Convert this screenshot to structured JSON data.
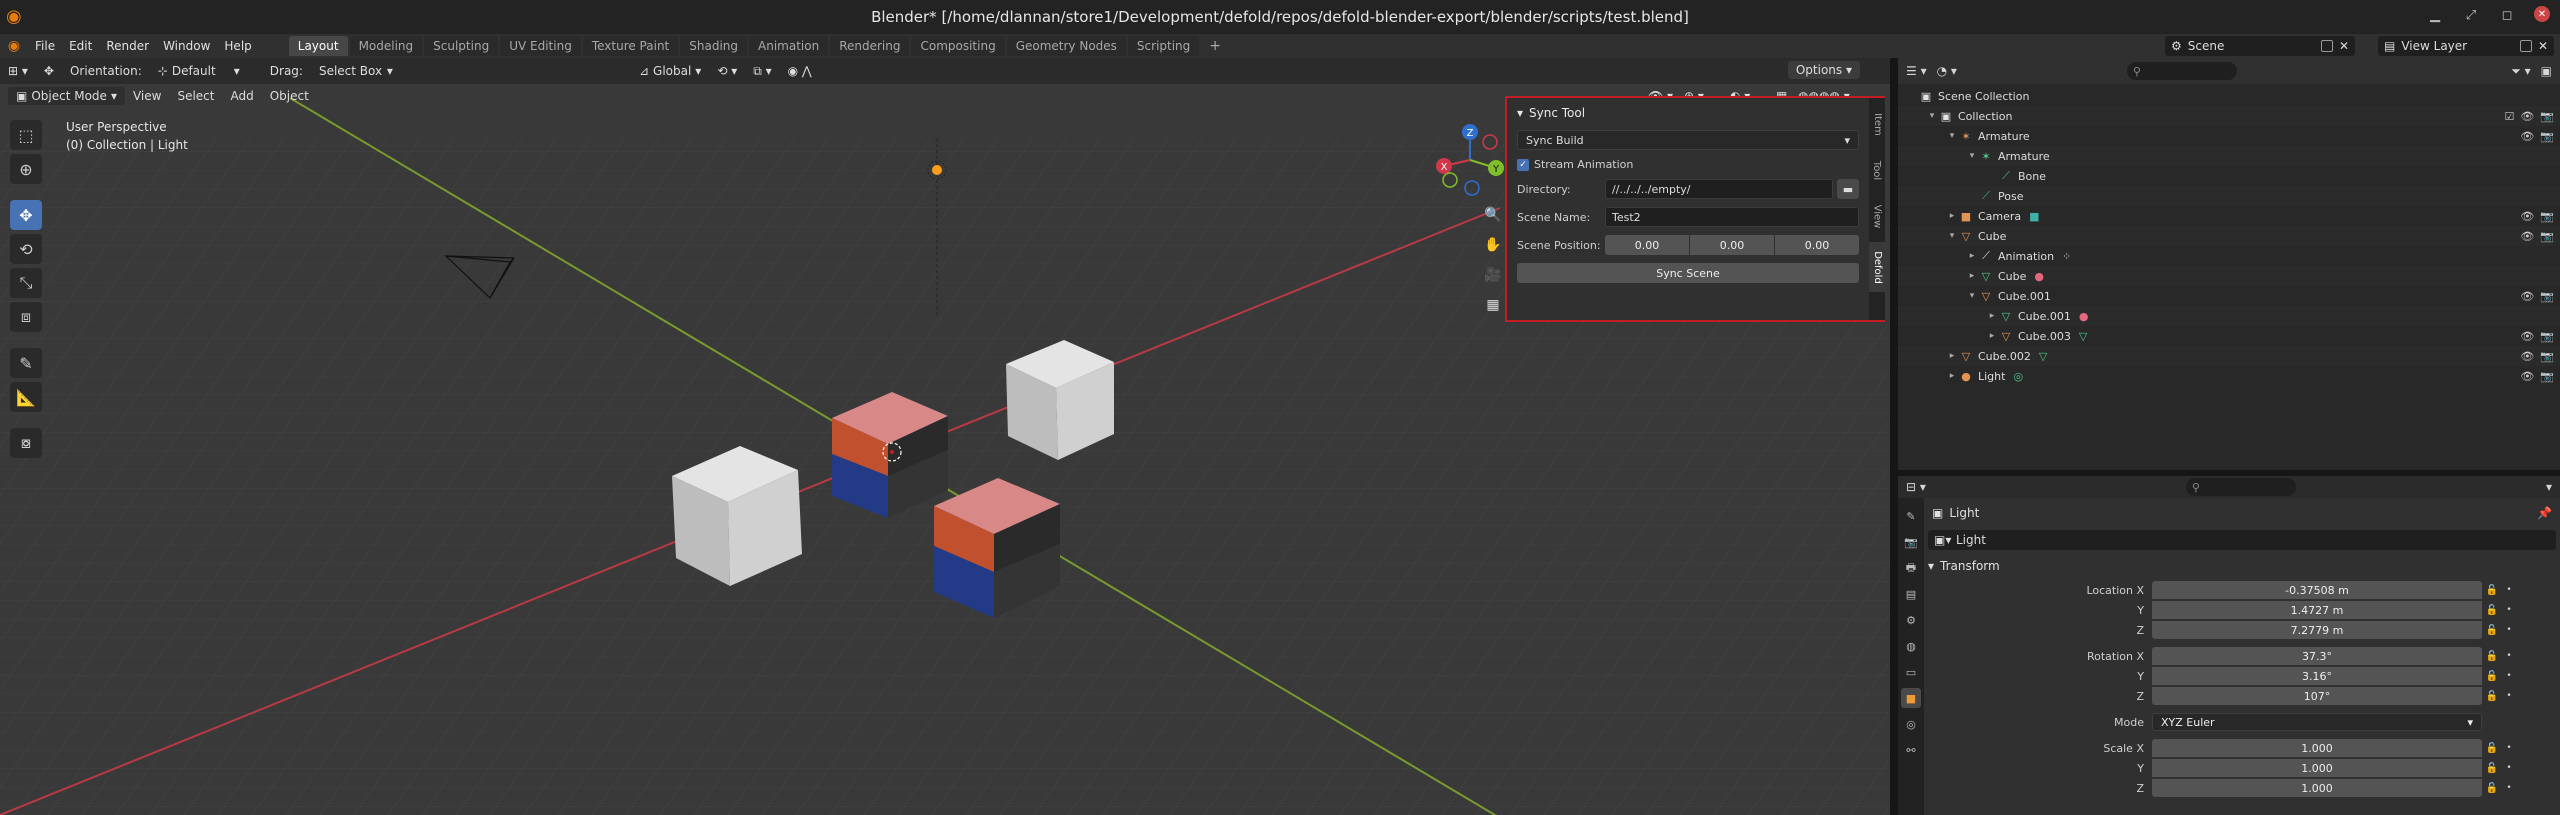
{
  "window": {
    "title": "Blender* [/home/dlannan/store1/Development/defold/repos/defold-blender-export/blender/scripts/test.blend]"
  },
  "menubar": {
    "menus": [
      "File",
      "Edit",
      "Render",
      "Window",
      "Help"
    ],
    "workspaces": [
      "Layout",
      "Modeling",
      "Sculpting",
      "UV Editing",
      "Texture Paint",
      "Shading",
      "Animation",
      "Rendering",
      "Compositing",
      "Geometry Nodes",
      "Scripting"
    ],
    "active_workspace": "Layout",
    "scene": "Scene",
    "view_layer": "View Layer"
  },
  "viewport_header": {
    "orientation_label": "Orientation:",
    "orientation_value": "Default",
    "drag_label": "Drag:",
    "drag_value": "Select Box",
    "transform_orientation": "Global",
    "options": "Options",
    "mode": "Object Mode",
    "menus": [
      "View",
      "Select",
      "Add",
      "Object"
    ]
  },
  "viewport_overlay": {
    "perspective": "User Perspective",
    "context": "(0) Collection | Light"
  },
  "gizmo": {
    "x": "X",
    "y": "Y",
    "z": "Z"
  },
  "sync_panel": {
    "title": "Sync Tool",
    "mode": "Sync Build",
    "stream_animation_label": "Stream Animation",
    "stream_animation_checked": true,
    "directory_label": "Directory:",
    "directory_value": "//../../../empty/",
    "scene_name_label": "Scene Name:",
    "scene_name_value": "Test2",
    "scene_position_label": "Scene Position:",
    "scene_position": [
      "0.00",
      "0.00",
      "0.00"
    ],
    "sync_button": "Sync Scene",
    "tabs": [
      "Item",
      "Tool",
      "View",
      "Defold"
    ],
    "active_tab": "Defold"
  },
  "outliner": {
    "items": [
      {
        "label": "Scene Collection",
        "depth": 0,
        "arrow": "",
        "icon": "scene-collection-icon",
        "glyph": "▣",
        "color": "coll",
        "extra": "",
        "vis": false
      },
      {
        "label": "Collection",
        "depth": 1,
        "arrow": "▾",
        "icon": "collection-icon",
        "glyph": "▣",
        "color": "coll",
        "extra": "",
        "vis": true,
        "check": true
      },
      {
        "label": "Armature",
        "depth": 2,
        "arrow": "▾",
        "icon": "armature-icon",
        "glyph": "✶",
        "color": "orange",
        "extra": "",
        "vis": true
      },
      {
        "label": "Armature",
        "depth": 3,
        "arrow": "▾",
        "icon": "armature-data-icon",
        "glyph": "✶",
        "color": "green",
        "extra": "",
        "vis": false
      },
      {
        "label": "Bone",
        "depth": 4,
        "arrow": "",
        "icon": "bone-icon",
        "glyph": "⟋",
        "color": "green",
        "extra": "",
        "vis": false
      },
      {
        "label": "Pose",
        "depth": 3,
        "arrow": "",
        "icon": "pose-icon",
        "glyph": "⟋",
        "color": "teal",
        "extra": "",
        "vis": false
      },
      {
        "label": "Camera",
        "depth": 2,
        "arrow": "▸",
        "icon": "camera-icon",
        "glyph": "■",
        "color": "orange",
        "extra": "■",
        "extraColor": "teal",
        "vis": true
      },
      {
        "label": "Cube",
        "depth": 2,
        "arrow": "▾",
        "icon": "mesh-object-icon",
        "glyph": "▽",
        "color": "orange",
        "extra": "",
        "vis": true
      },
      {
        "label": "Animation",
        "depth": 3,
        "arrow": "▸",
        "icon": "animation-icon",
        "glyph": "⟋",
        "color": "coll",
        "extra": "⁘",
        "extraColor": "coll",
        "vis": false
      },
      {
        "label": "Cube",
        "depth": 3,
        "arrow": "▸",
        "icon": "mesh-data-icon",
        "glyph": "▽",
        "color": "green",
        "extra": "●",
        "extraColor": "pink",
        "vis": false
      },
      {
        "label": "Cube.001",
        "depth": 3,
        "arrow": "▾",
        "icon": "mesh-object-icon",
        "glyph": "▽",
        "color": "orange",
        "extra": "",
        "vis": true
      },
      {
        "label": "Cube.001",
        "depth": 4,
        "arrow": "▸",
        "icon": "mesh-data-icon",
        "glyph": "▽",
        "color": "green",
        "extra": "●",
        "extraColor": "pink",
        "vis": false
      },
      {
        "label": "Cube.003",
        "depth": 4,
        "arrow": "▸",
        "icon": "mesh-object-icon",
        "glyph": "▽",
        "color": "orange",
        "extra": "▽",
        "extraColor": "green",
        "vis": true
      },
      {
        "label": "Cube.002",
        "depth": 2,
        "arrow": "▸",
        "icon": "mesh-object-icon",
        "glyph": "▽",
        "color": "orange",
        "extra": "▽",
        "extraColor": "green",
        "vis": true
      },
      {
        "label": "Light",
        "depth": 2,
        "arrow": "▸",
        "icon": "light-icon",
        "glyph": "●",
        "color": "orange",
        "extra": "◎",
        "extraColor": "green",
        "vis": true
      }
    ]
  },
  "properties": {
    "object_name": "Light",
    "name_field": "Light",
    "section": "Transform",
    "location": {
      "label": "Location X",
      "x": "-0.37508 m",
      "y": "1.4727 m",
      "z": "7.2779 m"
    },
    "rotation": {
      "label": "Rotation X",
      "x": "37.3°",
      "y": "3.16°",
      "z": "107°"
    },
    "mode_label": "Mode",
    "mode_value": "XYZ Euler",
    "scale": {
      "label": "Scale X",
      "x": "1.000",
      "y": "1.000",
      "z": "1.000"
    },
    "axis_y": "Y",
    "axis_z": "Z"
  }
}
